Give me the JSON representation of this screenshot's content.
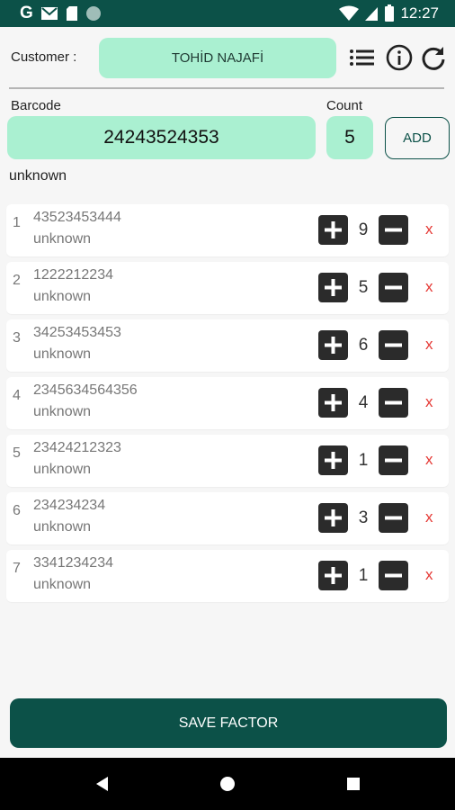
{
  "statusbar": {
    "time": "12:27",
    "left_icons": [
      "google-icon",
      "gmail-icon",
      "sd-card-icon",
      "sync-icon"
    ],
    "right_icons": [
      "wifi-icon",
      "signal-icon",
      "battery-icon"
    ]
  },
  "header": {
    "customer_label": "Customer :",
    "customer_name": "TOHİD NAJAFİ",
    "icons": [
      "list-icon",
      "info-icon",
      "refresh-icon"
    ]
  },
  "entry": {
    "barcode_label": "Barcode",
    "barcode_value": "24243524353",
    "count_label": "Count",
    "count_value": "5",
    "add_label": "ADD",
    "status_text": "unknown"
  },
  "items": [
    {
      "index": "1",
      "code": "43523453444",
      "name": "unknown",
      "count": "9",
      "delete": "x"
    },
    {
      "index": "2",
      "code": "1222212234",
      "name": "unknown",
      "count": "5",
      "delete": "x"
    },
    {
      "index": "3",
      "code": "34253453453",
      "name": "unknown",
      "count": "6",
      "delete": "x"
    },
    {
      "index": "4",
      "code": "2345634564356",
      "name": "unknown",
      "count": "4",
      "delete": "x"
    },
    {
      "index": "5",
      "code": "23424212323",
      "name": "unknown",
      "count": "1",
      "delete": "x"
    },
    {
      "index": "6",
      "code": "234234234",
      "name": "unknown",
      "count": "3",
      "delete": "x"
    },
    {
      "index": "7",
      "code": "3341234234",
      "name": "unknown",
      "count": "1",
      "delete": "x"
    }
  ],
  "save_label": "SAVE FACTOR",
  "navbar": {
    "icons": [
      "back-icon",
      "home-icon",
      "recents-icon"
    ]
  },
  "colors": {
    "primary": "#0c5148",
    "field_bg": "#aaf0d1",
    "delete": "#e53935",
    "qty_button": "#2b2b2b"
  }
}
